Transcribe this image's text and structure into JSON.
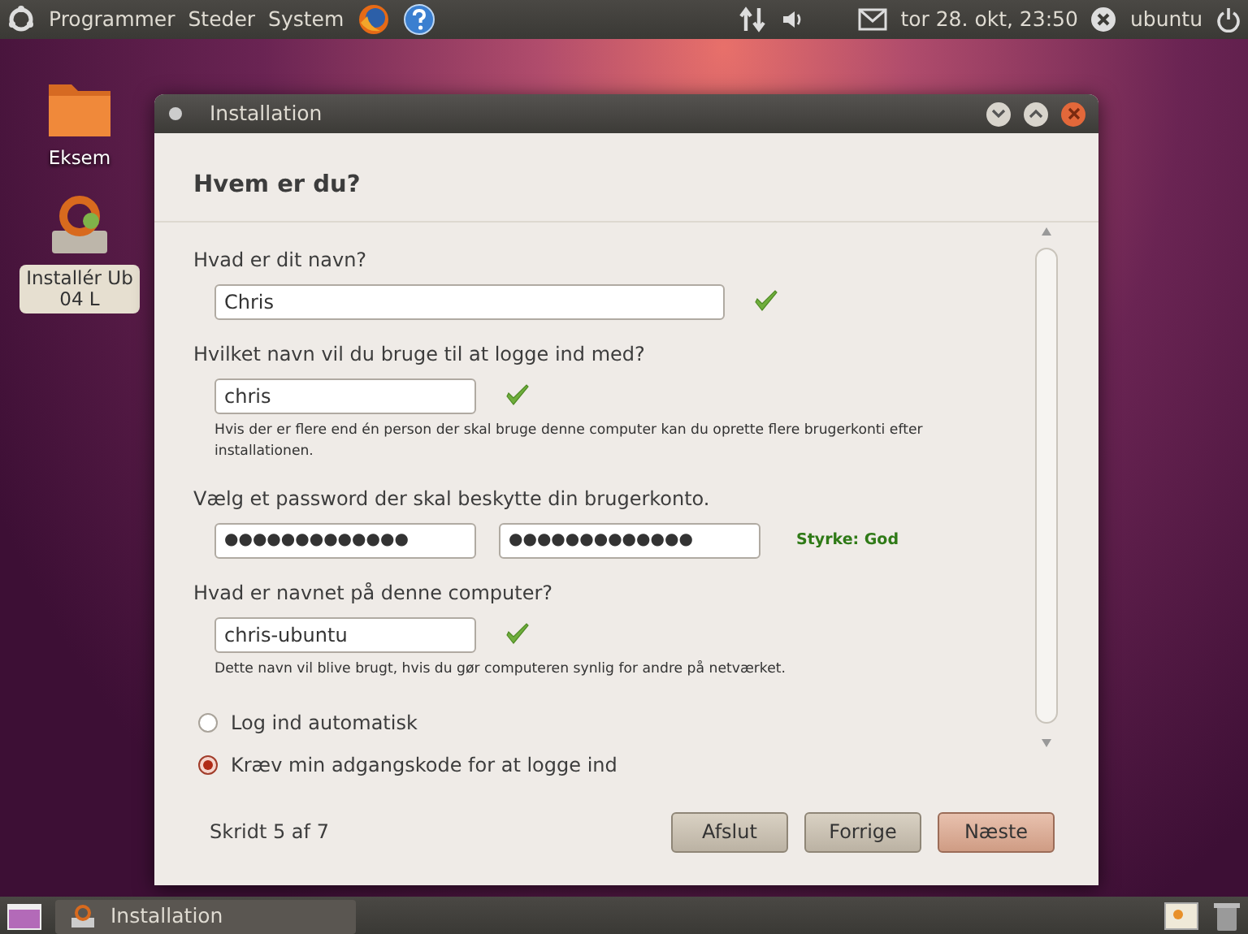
{
  "top_panel": {
    "menus": [
      "Programmer",
      "Steder",
      "System"
    ],
    "clock": "tor 28. okt, 23:50",
    "user": "ubuntu"
  },
  "desktop_icons": [
    {
      "kind": "folder",
      "lines": [
        "Eksem"
      ],
      "selected": false
    },
    {
      "kind": "installer",
      "lines": [
        "Installér Ub",
        "04 L"
      ],
      "selected": true
    }
  ],
  "window": {
    "title": "Installation",
    "heading": "Hvem er du?",
    "fields": [
      {
        "label": "Hvad er dit navn?",
        "inputs": [
          "Chris"
        ],
        "valid": true
      },
      {
        "label": "Hvilket navn vil du bruge til at logge ind med?",
        "inputs": [
          "chris"
        ],
        "valid": true,
        "hint": "Hvis der er flere end én person der skal bruge denne computer kan du oprette flere brugerkonti efter installationen."
      },
      {
        "label": "Vælg et password der skal beskytte din brugerkonto.",
        "inputs": [
          "●●●●●●●●●●●●●",
          "●●●●●●●●●●●●●"
        ],
        "valid": false,
        "strength": "Styrke: God"
      },
      {
        "label": "Hvad er navnet på denne computer?",
        "inputs": [
          "chris-ubuntu"
        ],
        "valid": true,
        "hint": "Dette navn vil blive brugt, hvis du gør computeren synlig for andre på netværket."
      }
    ],
    "radios": [
      {
        "label": "Log ind automatisk",
        "selected": false
      },
      {
        "label": "Kræv min adgangskode for at logge ind",
        "selected": true
      }
    ],
    "step": "Skridt 5 af 7",
    "buttons": [
      {
        "label": "Afslut",
        "default": false
      },
      {
        "label": "Forrige",
        "default": false
      },
      {
        "label": "Næste",
        "default": true
      }
    ]
  },
  "taskbar": {
    "tasks": [
      {
        "label": "Installation"
      }
    ]
  }
}
